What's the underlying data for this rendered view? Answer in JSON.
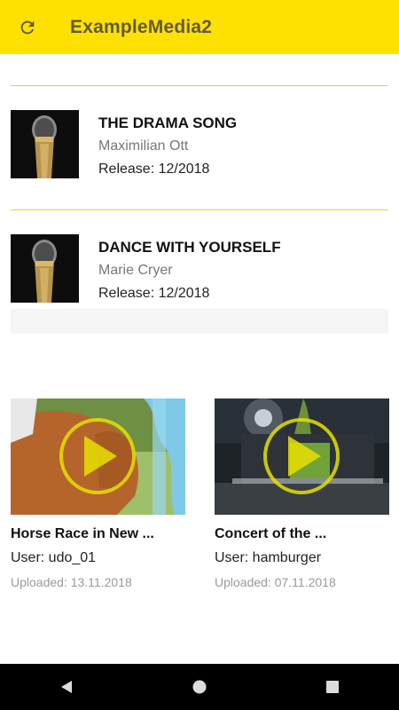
{
  "appbar": {
    "title": "ExampleMedia2",
    "refresh_icon": "refresh-icon",
    "color": "#fee100"
  },
  "songs": [
    {
      "title": "THE DRAMA SONG",
      "artist": "Maximilian Ott",
      "release": "Release: 12/2018",
      "thumbnail": "microphone"
    },
    {
      "title": "DANCE WITH YOURSELF",
      "artist": "Marie Cryer",
      "release": "Release: 12/2018",
      "thumbnail": "microphone"
    }
  ],
  "videos": [
    {
      "title": "Horse Race in New ...",
      "user": "User: udo_01",
      "uploaded": "Uploaded: 13.11.2018",
      "thumbnail": "horse-race",
      "overlay_icon": "play-icon"
    },
    {
      "title": "Concert of the ...",
      "user": "User: hamburger",
      "uploaded": "Uploaded: 07.11.2018",
      "thumbnail": "concert-stage",
      "overlay_icon": "play-icon"
    }
  ],
  "navbar": {
    "back_icon": "back-triangle-icon",
    "home_icon": "home-circle-icon",
    "recents_icon": "recents-square-icon"
  },
  "colors": {
    "accent": "#fee100",
    "divider": "#f0cf2c",
    "play_overlay": "#e6e000"
  }
}
